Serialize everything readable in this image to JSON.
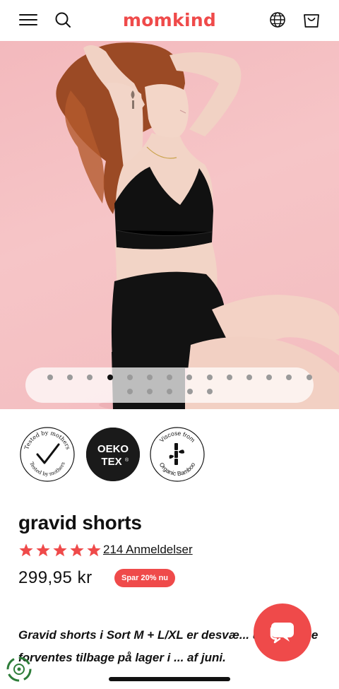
{
  "header": {
    "logo": "momkind",
    "icons": [
      "menu-icon",
      "search-icon",
      "globe-icon",
      "bag-icon"
    ]
  },
  "gallery": {
    "image_alt": "Model wearing black bralette and black maternity shorts against pink background",
    "total_slides": 19,
    "active_slide": 4
  },
  "badges": {
    "tested": {
      "arc_top": "Tested by mothers",
      "arc_bottom": "Tested by mothers"
    },
    "oeko": {
      "line1": "OEKO",
      "line2": "TEX",
      "mark": "®"
    },
    "viscose": {
      "line1": "Viscose from",
      "line2": "Organic Bamboo"
    }
  },
  "product": {
    "title": "gravid shorts",
    "rating": 5,
    "reviews_label": "214 Anmeldelser",
    "price": "299,95 kr",
    "save_badge": "Spar 20% nu",
    "description": "Gravid shorts i Sort M + L/XL er desvæ... udsolgt. De forventes tilbage på lager i ... af juni."
  },
  "colors": {
    "brand": "#ef4a4a",
    "hero_bg": "#f4bdc0",
    "text": "#111111"
  }
}
